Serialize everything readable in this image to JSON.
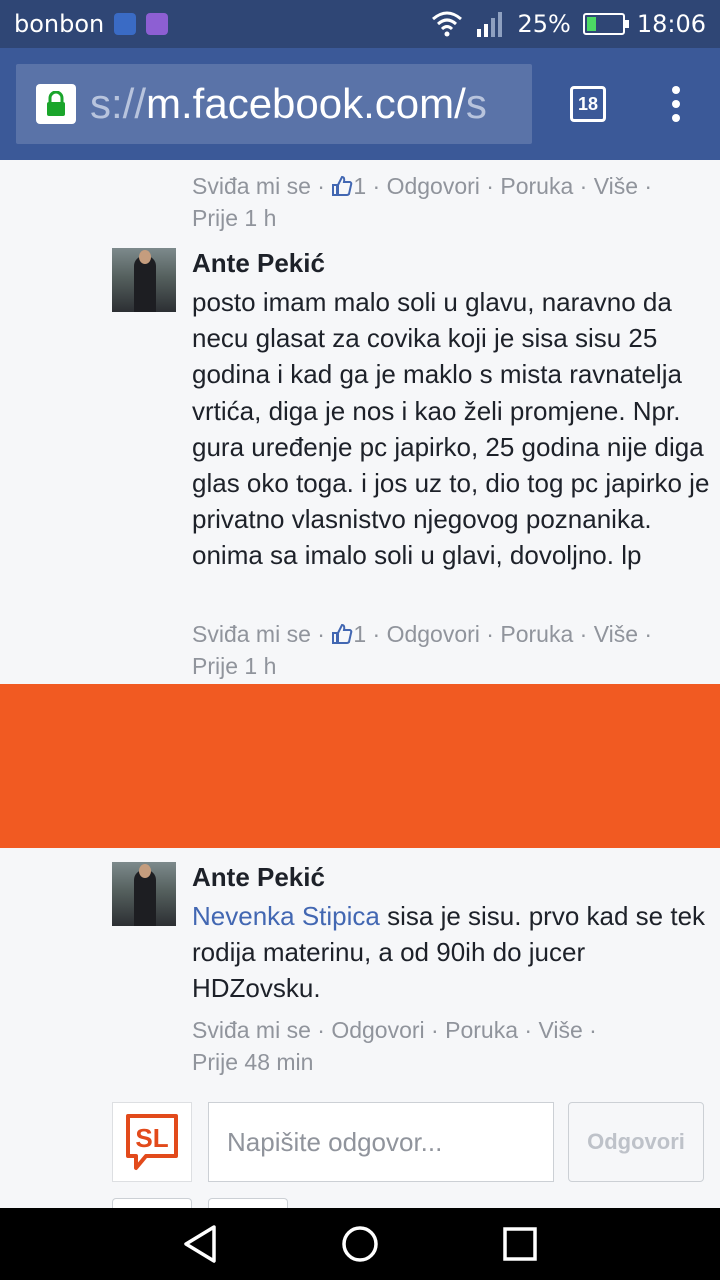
{
  "status_bar": {
    "carrier": "bonbon",
    "battery": "25%",
    "battery_level": 0.25,
    "time": "18:06"
  },
  "browser": {
    "url_prefix": "s://",
    "url_main": "m.facebook.com/",
    "url_suffix": "s",
    "tab_count": "18"
  },
  "top_meta": {
    "like": "Sviđa mi se",
    "like_count": "1",
    "reply": "Odgovori",
    "message": "Poruka",
    "more": "Više",
    "time": "Prije 1 h"
  },
  "comments": [
    {
      "author": "Ante Pekić",
      "text": "posto imam malo soli u glavu, naravno da necu glasat za covika koji je sisa sisu 25 godina i kad ga je maklo s mista ravnatelja vrtića, diga je nos i kao želi promjene. Npr. gura uređenje pc japirko, 25 godina nije diga glas oko toga. i jos uz to, dio tog pc japirko je privatno vlasnistvo njegovog poznanika. onima sa imalo soli u glavi, dovoljno. lp",
      "like": "Sviđa mi se",
      "like_count": "1",
      "reply": "Odgovori",
      "message": "Poruka",
      "more": "Više",
      "time": "Prije 1 h"
    },
    {
      "author": "Ante Pekić",
      "mention": "Nevenka Stipica",
      "text": " sisa je sisu. prvo kad se tek rodija materinu, a od 90ih do jucer HDZovsku.",
      "like": "Sviđa mi se",
      "reply": "Odgovori",
      "message": "Poruka",
      "more": "Više",
      "time": "Prije 48 min"
    }
  ],
  "reply_box": {
    "logo": "SL",
    "placeholder": "Napišite odgovor...",
    "button": "Odgovori"
  },
  "colors": {
    "status_bar": "#2f4675",
    "browser_bar": "#3b5998",
    "ad_banner": "#f15a22",
    "meta_text": "#90949c",
    "mention": "#4267b2"
  }
}
